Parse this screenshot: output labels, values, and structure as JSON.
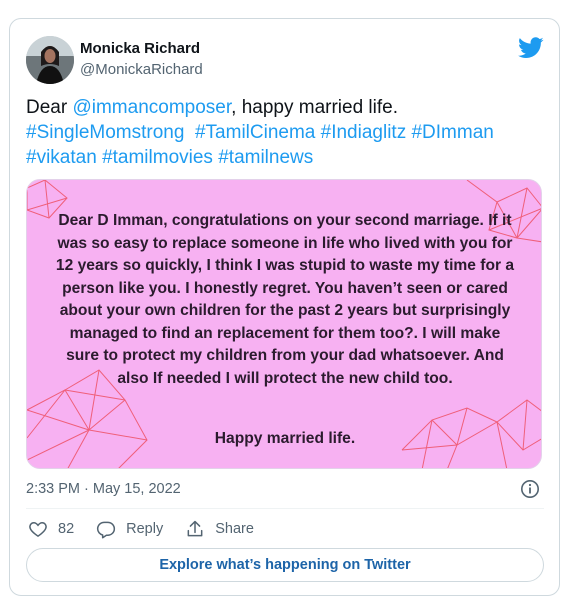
{
  "author": {
    "name": "Monicka Richard",
    "handle": "@MonickaRichard"
  },
  "tweet": {
    "text_parts": [
      {
        "text": "Dear ",
        "link": false
      },
      {
        "text": "@immancomposer",
        "link": true
      },
      {
        "text": ", happy married life.",
        "link": false
      }
    ],
    "hashtags_line1": [
      "#SingleMomstrong",
      "#TamilCinema",
      "#Indiaglitz",
      "#DImman"
    ],
    "hashtags_line2": [
      "#vikatan",
      "#tamilmovies",
      "#tamilnews"
    ]
  },
  "media": {
    "letter": "Dear D Imman, congratulations on your second marriage. If it was so easy to replace someone in life who lived with you for 12 years so quickly, I think I was stupid to waste my time for a person like you. I honestly regret. You haven’t seen or cared about your own children for the past 2 years but surprisingly managed to find an replacement for them too?. I will make sure to protect my children from your dad whatsoever. And also If needed I will protect the new child too.",
    "closing": "Happy married life.",
    "background_color": "#f7b1f2",
    "line_color": "#ef5f7a"
  },
  "meta": {
    "timestamp": "2:33 PM · May 15, 2022"
  },
  "actions": {
    "like_count": "82",
    "reply_label": "Reply",
    "share_label": "Share"
  },
  "explore": {
    "label": "Explore what’s happening on Twitter"
  },
  "colors": {
    "link": "#1d9bf0",
    "secondary_text": "#536471",
    "twitter_blue": "#1d9bf0"
  }
}
